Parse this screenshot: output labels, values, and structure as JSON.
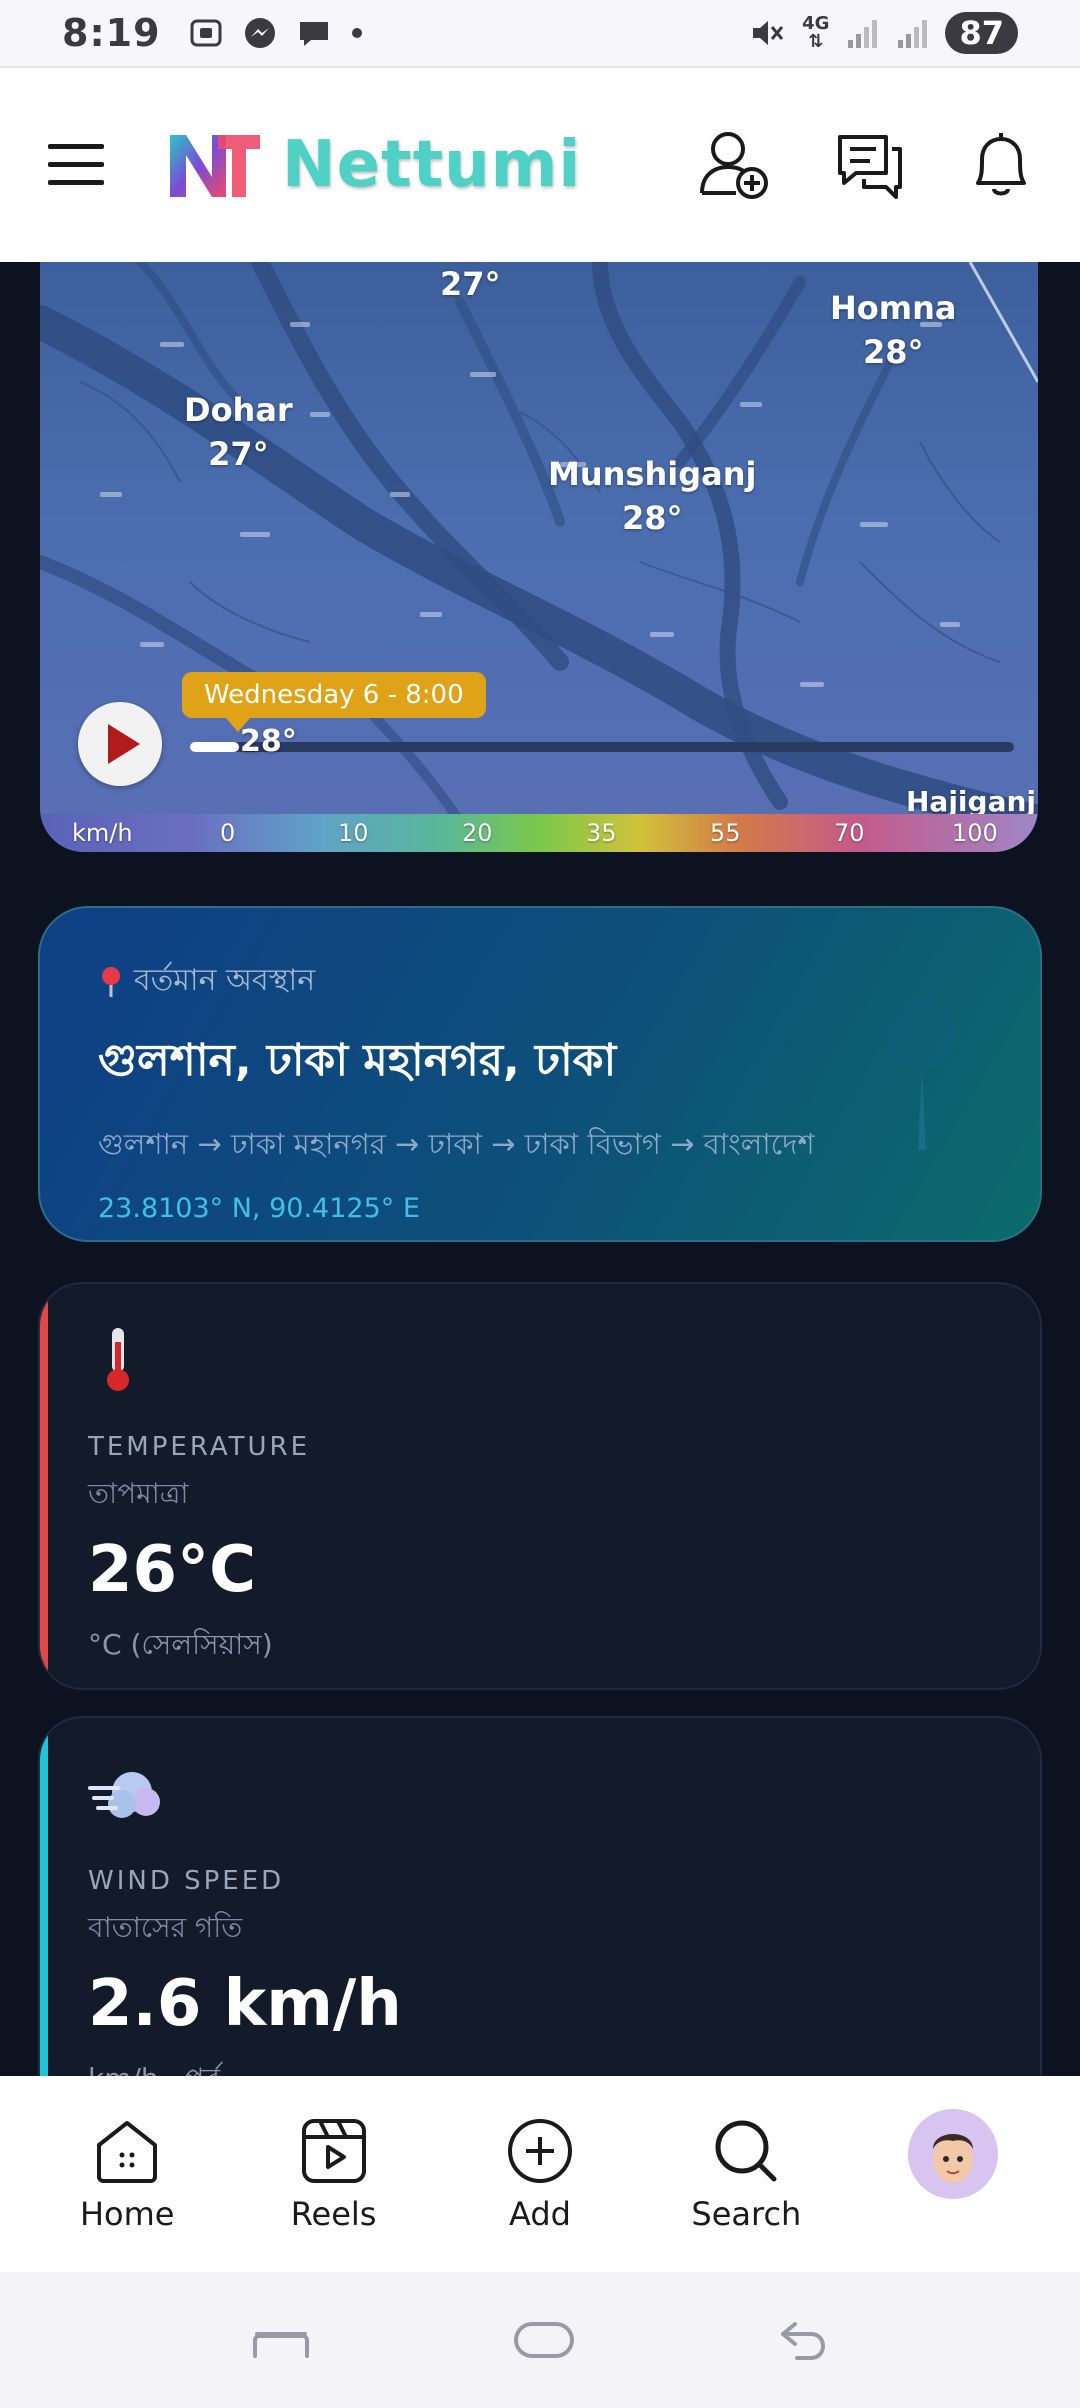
{
  "status_bar": {
    "time": "8:19",
    "network": "4G",
    "battery": "87"
  },
  "header": {
    "brand": "Nettumi"
  },
  "map": {
    "cities": [
      {
        "name": "",
        "temp": "27°"
      },
      {
        "name": "Homna",
        "temp": "28°"
      },
      {
        "name": "Dohar",
        "temp": "27°"
      },
      {
        "name": "Munshiganj",
        "temp": "28°"
      },
      {
        "name": "Hajiganj",
        "temp": ""
      }
    ],
    "timeline_label": "Wednesday 6 - 8:00",
    "slider_temp": "28°",
    "timeline_progress": 0.06,
    "scale_unit": "km/h",
    "scale_ticks": [
      "0",
      "10",
      "20",
      "35",
      "55",
      "70",
      "100"
    ]
  },
  "location": {
    "label": "বর্তমান অবস্থান",
    "title": "গুলশান, ঢাকা মহানগর, ঢাকা",
    "path": "গুলশান → ঢাকা মহানগর → ঢাকা → ঢাকা বিভাগ → বাংলাদেশ",
    "coords": "23.8103° N, 90.4125° E"
  },
  "metrics": [
    {
      "icon": "thermometer-icon",
      "accent": "#e04848",
      "label_en": "TEMPERATURE",
      "label_bn": "তাপমাত্রা",
      "value": "26°C",
      "unit": "°C (সেলসিয়াস)"
    },
    {
      "icon": "wind-icon",
      "accent": "#22c3d9",
      "label_en": "WIND SPEED",
      "label_bn": "বাতাসের গতি",
      "value": "2.6 km/h",
      "unit": "km/h · পূর্ব"
    }
  ],
  "bottom_nav": {
    "items": [
      {
        "label": "Home"
      },
      {
        "label": "Reels"
      },
      {
        "label": "Add"
      },
      {
        "label": "Search"
      }
    ]
  }
}
